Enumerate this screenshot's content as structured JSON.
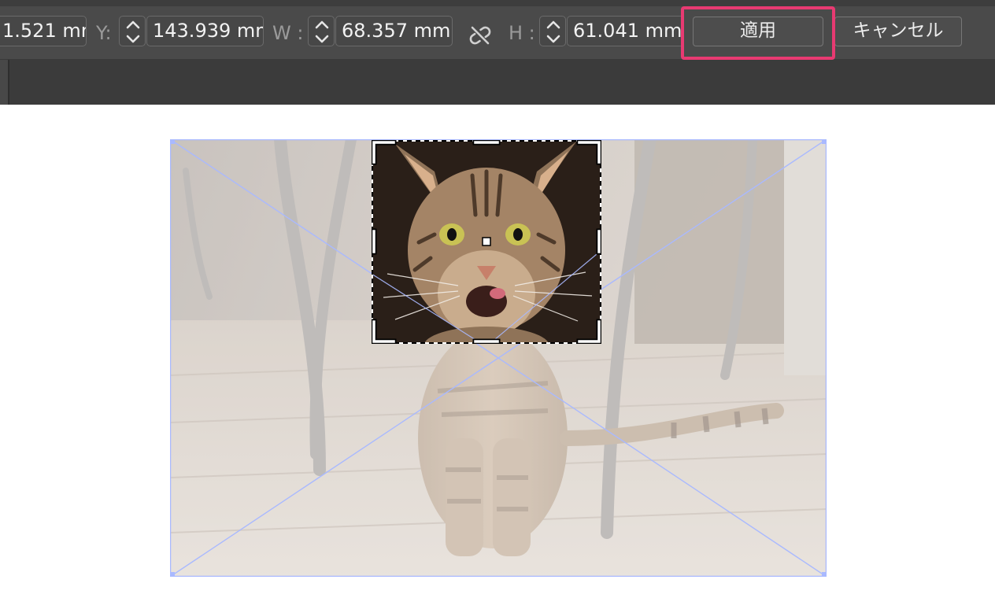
{
  "toolbar": {
    "x_value": "1.521",
    "x_unit": "mm",
    "y_label": "Y:",
    "y_value": "143.939",
    "y_unit": "mm",
    "w_label": "W :",
    "w_value": "68.357",
    "w_unit": "mm",
    "h_label": "H :",
    "h_value": "61.041",
    "h_unit": "mm",
    "apply_label": "適用",
    "cancel_label": "キャンセル",
    "link_icon": "unlink-icon",
    "colors": {
      "toolbar_bg": "#4a4a4a",
      "field_border": "#6a6a6a",
      "highlight": "#e83a72",
      "frame_selection": "#a9b9ff"
    }
  },
  "canvas": {
    "image_subject": "tabby-cat-photo",
    "crop_region_subject": "cat-face"
  }
}
